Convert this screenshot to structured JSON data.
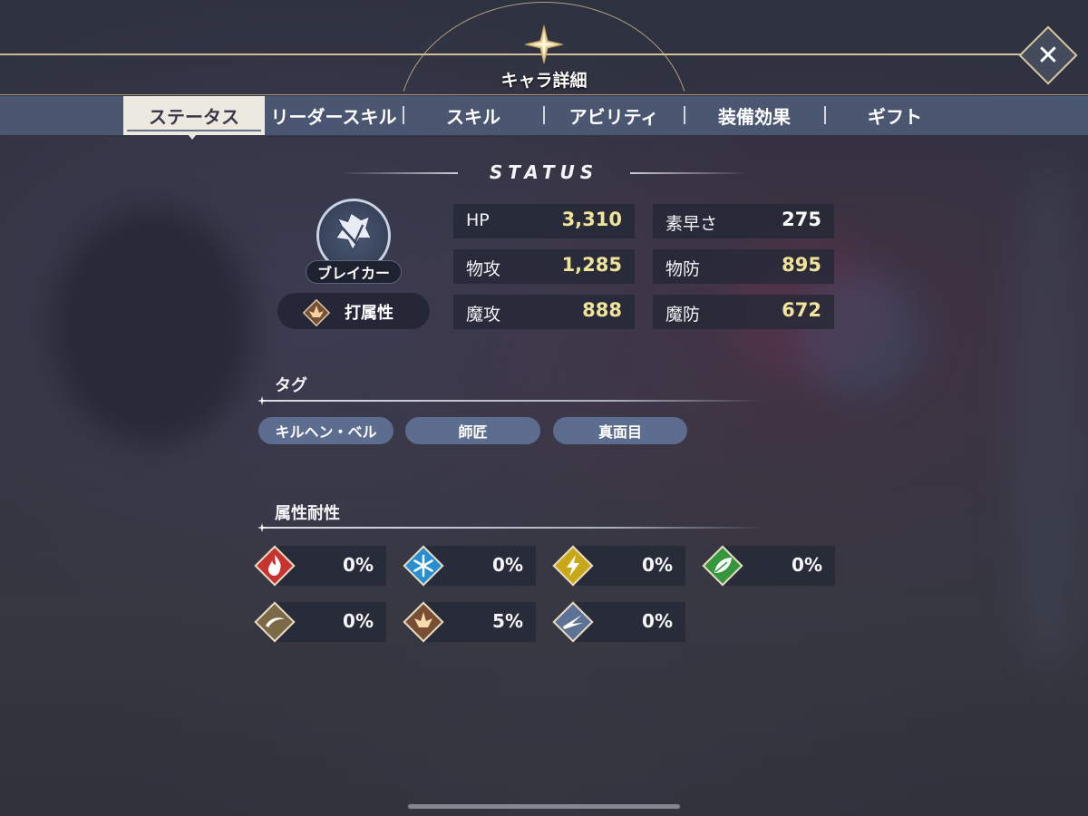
{
  "header": {
    "title": "キャラ詳細",
    "close_label": "✕"
  },
  "tabs": [
    {
      "label": "ステータス",
      "active": true
    },
    {
      "label": "リーダースキル",
      "active": false
    },
    {
      "label": "スキル",
      "active": false
    },
    {
      "label": "アビリティ",
      "active": false
    },
    {
      "label": "装備効果",
      "active": false
    },
    {
      "label": "ギフト",
      "active": false
    }
  ],
  "status": {
    "heading": "STATUS",
    "class_name": "ブレイカー",
    "attribute": "打属性",
    "stats": [
      {
        "name": "HP",
        "value": "3,310",
        "highlight": true
      },
      {
        "name": "素早さ",
        "value": "275",
        "highlight": false
      },
      {
        "name": "物攻",
        "value": "1,285",
        "highlight": true
      },
      {
        "name": "物防",
        "value": "895",
        "highlight": true
      },
      {
        "name": "魔攻",
        "value": "888",
        "highlight": true
      },
      {
        "name": "魔防",
        "value": "672",
        "highlight": true
      }
    ]
  },
  "tags": {
    "title": "タグ",
    "items": [
      "キルヘン・ベル",
      "師匠",
      "真面目"
    ]
  },
  "resistances": {
    "title": "属性耐性",
    "items": [
      {
        "element": "fire",
        "icon": "fire-icon",
        "color": "#d23a36",
        "value": "0%"
      },
      {
        "element": "ice",
        "icon": "snowflake-icon",
        "color": "#2f9ad6",
        "value": "0%"
      },
      {
        "element": "lightning",
        "icon": "lightning-icon",
        "color": "#d2b21c",
        "value": "0%"
      },
      {
        "element": "wind",
        "icon": "leaf-icon",
        "color": "#3c9e44",
        "value": "0%"
      },
      {
        "element": "slash",
        "icon": "slash-icon",
        "color": "#8c7a52",
        "value": "0%"
      },
      {
        "element": "strike",
        "icon": "strike-icon",
        "color": "#8c5a36",
        "value": "5%"
      },
      {
        "element": "pierce",
        "icon": "pierce-icon",
        "color": "#6a7ea0",
        "value": "0%"
      }
    ]
  },
  "colors": {
    "accent_gold": "#e0c896",
    "stat_highlight": "#f0e39a",
    "tab_active_bg": "#ece9e1",
    "tag_bg": "#5d6d90"
  }
}
